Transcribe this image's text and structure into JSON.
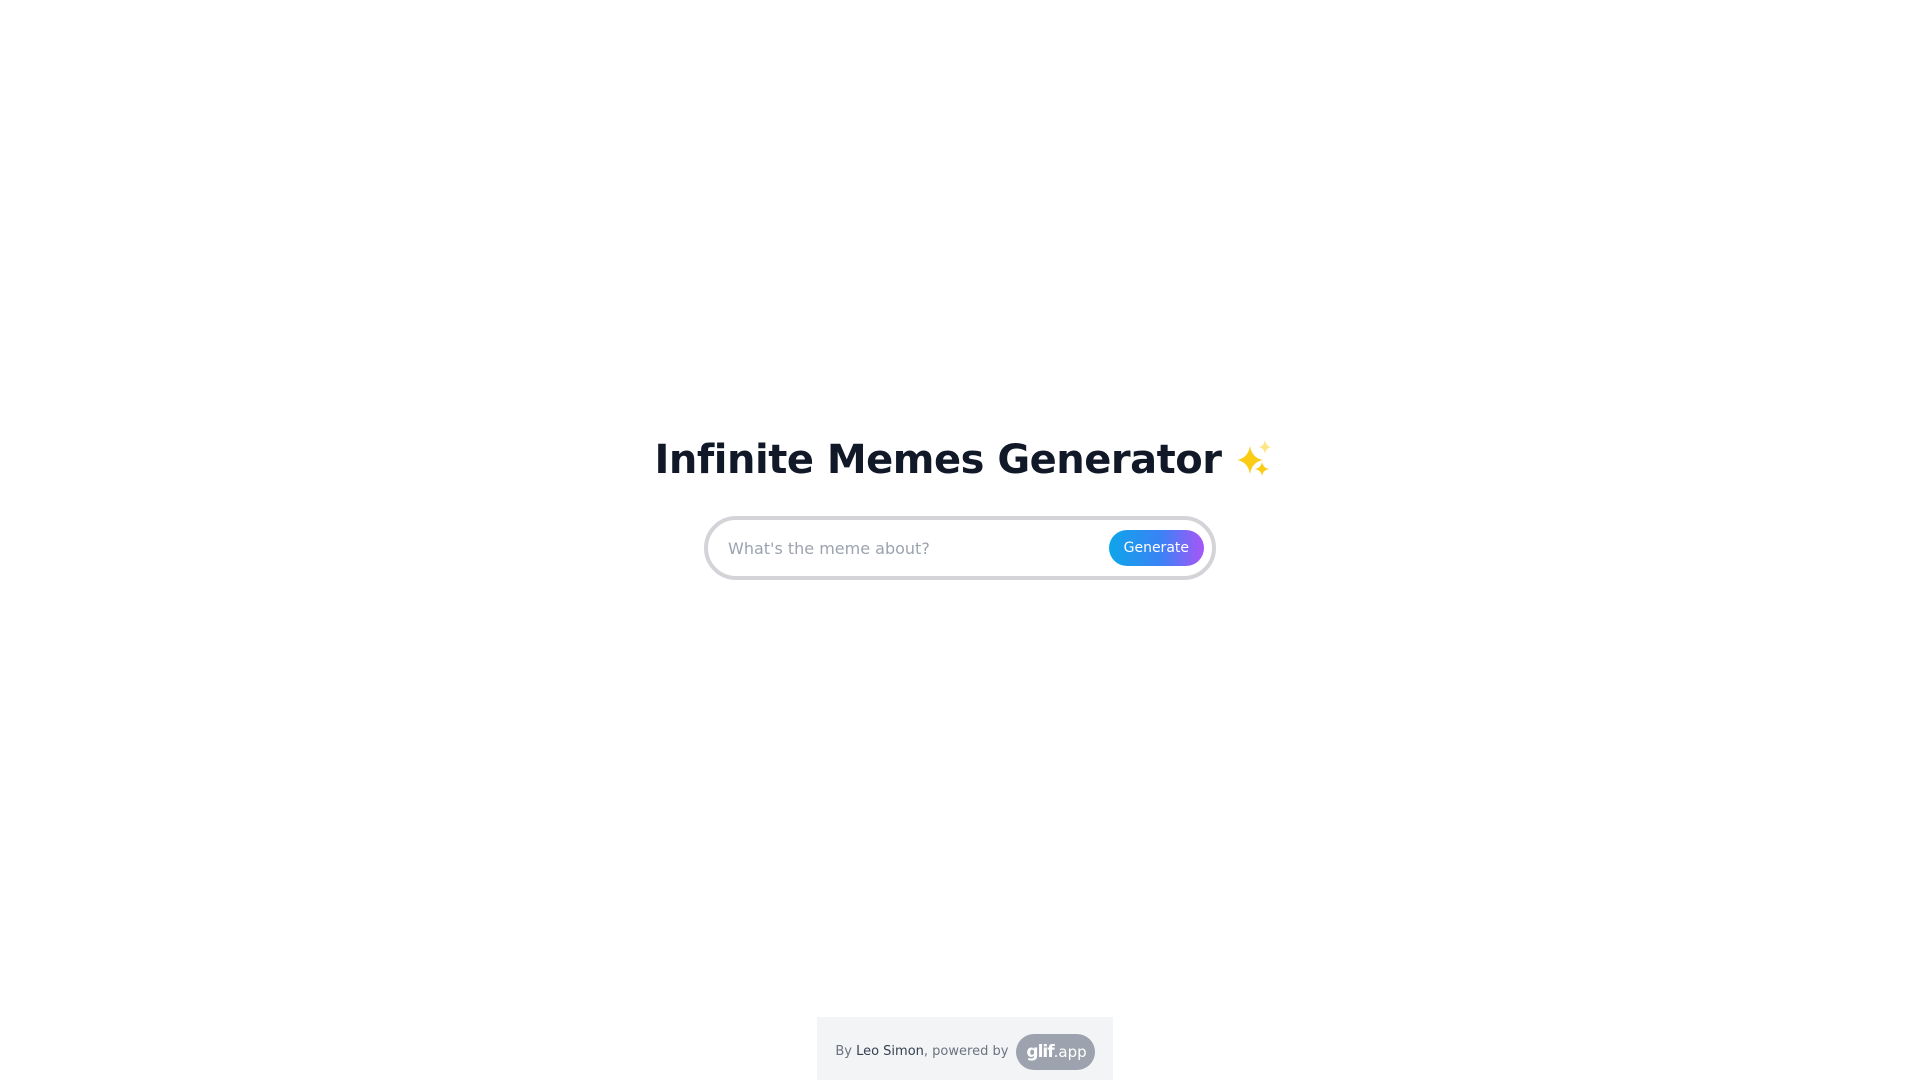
{
  "hero": {
    "title": "Infinite Memes Generator",
    "title_icon": "sparkles-icon"
  },
  "search": {
    "value": "",
    "placeholder": "What's the meme about?",
    "button_label": "Generate"
  },
  "footer": {
    "prefix": "By ",
    "author": "Leo Simon",
    "separator": ", powered by",
    "badge_logo": "glif",
    "badge_suffix": ".app"
  },
  "colors": {
    "title": "#111827",
    "sparkle": "#facc15",
    "button_gradient": [
      "#0ea5e9",
      "#3b82f6",
      "#a855f7"
    ],
    "input_border": "#d4d4d8",
    "footer_bg": "#f3f4f6",
    "badge_bg": "#9ca3af"
  }
}
